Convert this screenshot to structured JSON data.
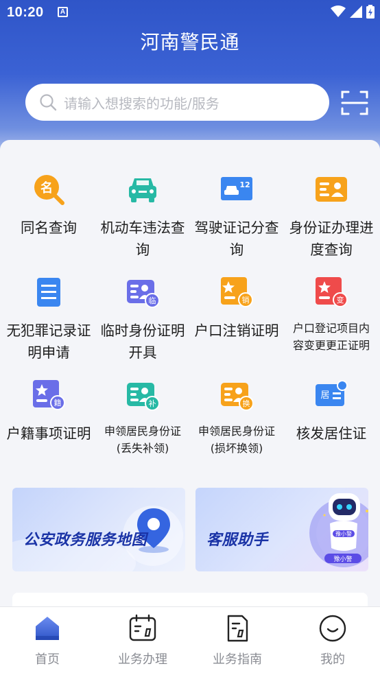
{
  "status_bar": {
    "time": "10:20",
    "notif_letter": "A"
  },
  "header": {
    "title": "河南警民通"
  },
  "search": {
    "placeholder": "请输入想搜索的功能/服务"
  },
  "services": [
    {
      "label": "同名查询",
      "icon": "name-search-icon"
    },
    {
      "label": "机动车违法查询",
      "icon": "car-icon"
    },
    {
      "label": "驾驶证记分查询",
      "icon": "license-points-icon"
    },
    {
      "label": "身份证办理进度查询",
      "icon": "id-card-icon"
    },
    {
      "label": "无犯罪记录证明申请",
      "icon": "document-icon"
    },
    {
      "label": "临时身份证明开具",
      "icon": "temp-id-icon",
      "badge": "临"
    },
    {
      "label": "户口注销证明",
      "icon": "household-cancel-icon",
      "badge": "销"
    },
    {
      "label": "户口登记项目内容变更更正证明",
      "icon": "household-change-icon",
      "badge": "变"
    },
    {
      "label": "户籍事项证明",
      "icon": "household-register-icon",
      "badge": "籍"
    },
    {
      "label": "申领居民身份证(丢失补领)",
      "icon": "id-reissue-icon",
      "badge": "补"
    },
    {
      "label": "申领居民身份证(损坏换领)",
      "icon": "id-replace-icon",
      "badge": "换"
    },
    {
      "label": "核发居住证",
      "icon": "residence-permit-icon",
      "badge": "居"
    }
  ],
  "banners": {
    "map": "公安政务服务地图",
    "service": "客服助手",
    "mascot_name": "豫小警"
  },
  "tabs": [
    {
      "label": "首页",
      "icon": "home-icon"
    },
    {
      "label": "业务办理",
      "icon": "calendar-icon"
    },
    {
      "label": "业务指南",
      "icon": "guide-icon"
    },
    {
      "label": "我的",
      "icon": "smile-icon"
    }
  ],
  "colors": {
    "primary": "#2f55c8",
    "orange": "#f7a21b",
    "teal": "#27b9a5",
    "blue": "#3a86f0",
    "red": "#ef4b4b",
    "purple": "#6a6ee8"
  }
}
